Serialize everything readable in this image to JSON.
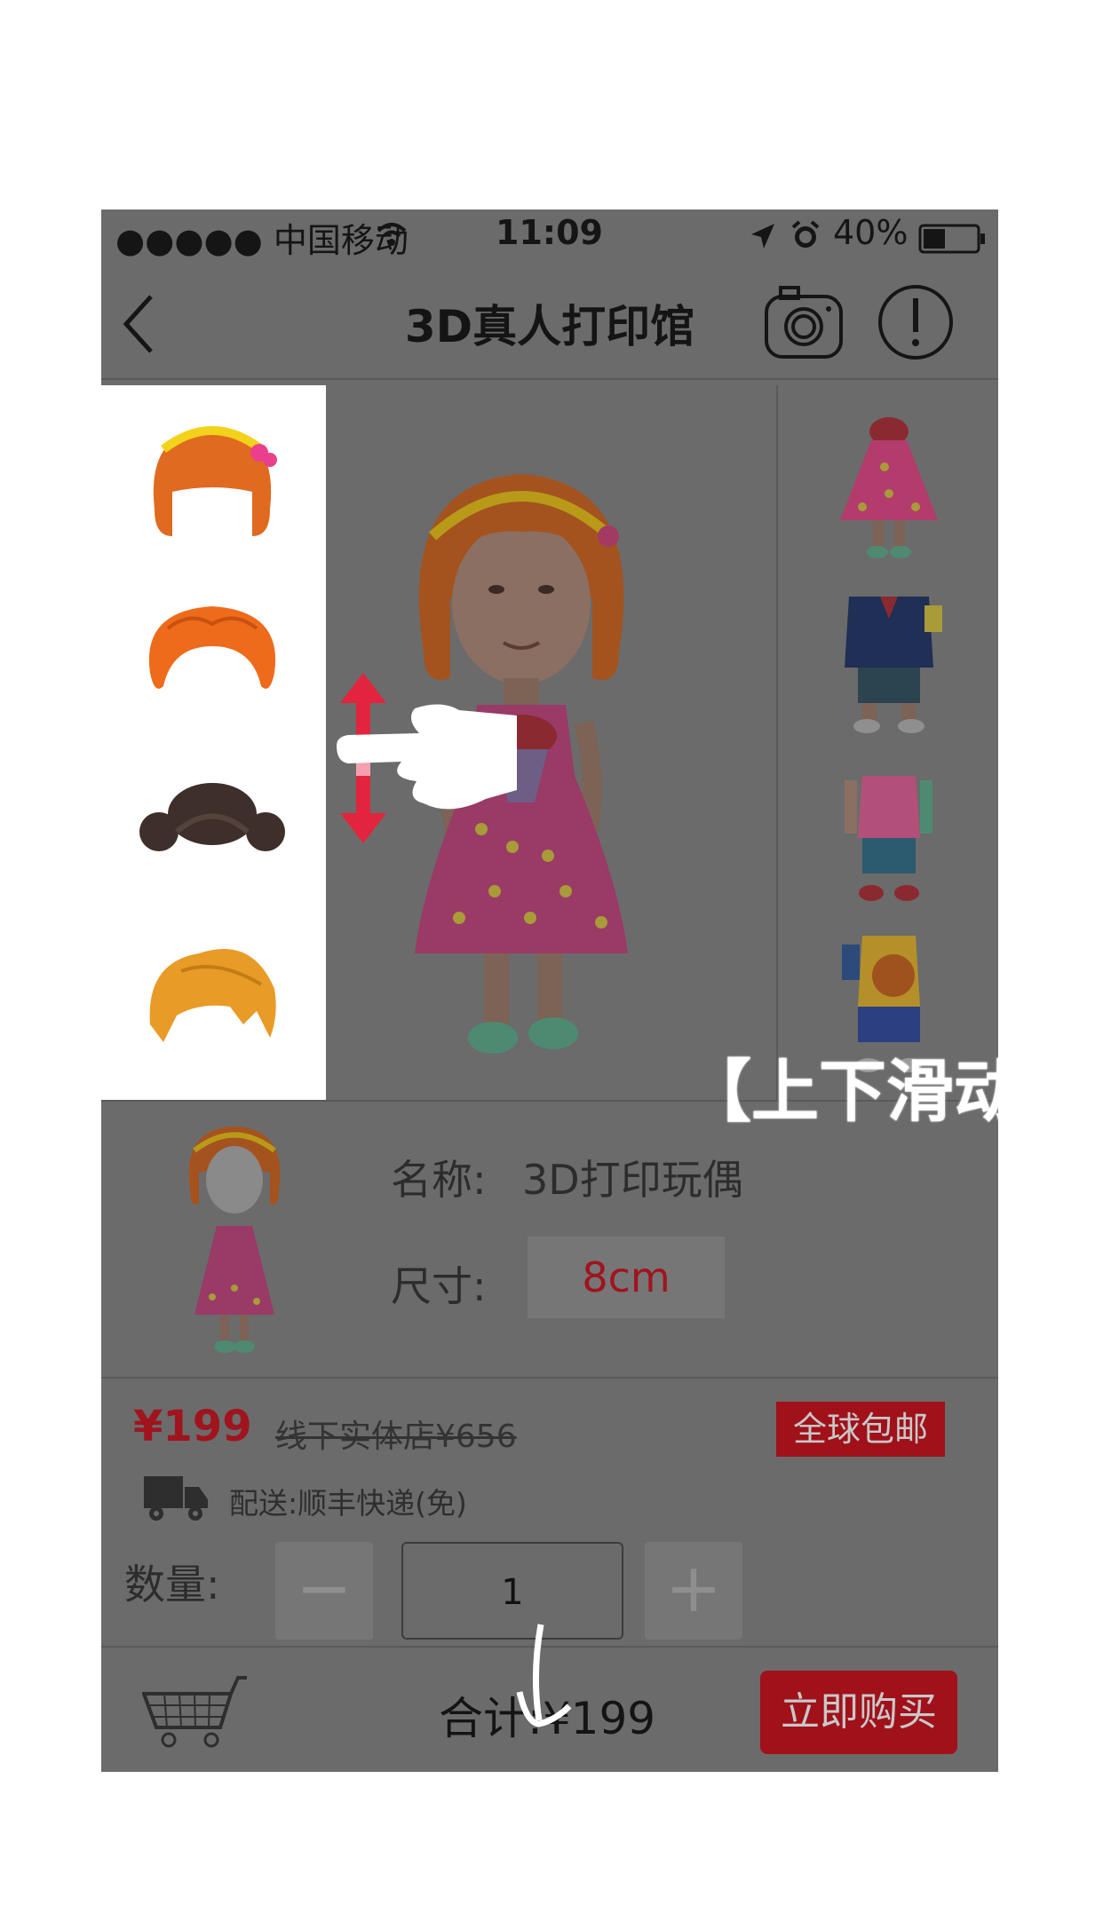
{
  "status_bar": {
    "carrier": "●●●●● 中国移动",
    "time": "11:09",
    "battery": "40%"
  },
  "nav": {
    "title": "3D真人打印馆"
  },
  "hair_styles": [
    {
      "name": "bob-with-headband",
      "color": "#e06a20"
    },
    {
      "name": "curly-updo",
      "color": "#ee6b1c"
    },
    {
      "name": "twin-buns",
      "color": "#3e2f2a"
    },
    {
      "name": "spiky-short",
      "color": "#e89b26"
    }
  ],
  "outfits": [
    {
      "name": "pink-polka-dress",
      "color": "#e0457a"
    },
    {
      "name": "navy-jacket-suit",
      "color": "#1f2f55"
    },
    {
      "name": "pink-tank-top",
      "color": "#e06a96"
    },
    {
      "name": "basketball-jersey",
      "color": "#e2b22a"
    }
  ],
  "overlay": {
    "hint": "【上下滑动】"
  },
  "product": {
    "name_label": "名称:",
    "name_value": "3D打印玩偶",
    "size_label": "尺寸:",
    "size_value": "8cm"
  },
  "price": {
    "current": "¥199",
    "original": "线下实体店¥656",
    "badge": "全球包邮",
    "shipping": "配送:顺丰快递(免)",
    "qty_label": "数量:",
    "quantity": "1",
    "minus": "−",
    "plus": "+"
  },
  "bottom": {
    "total": "合计:¥199",
    "buy_label": "立即购买"
  },
  "colors": {
    "accent_red": "#a0111a",
    "dim_gray": "#6b6b6b"
  }
}
